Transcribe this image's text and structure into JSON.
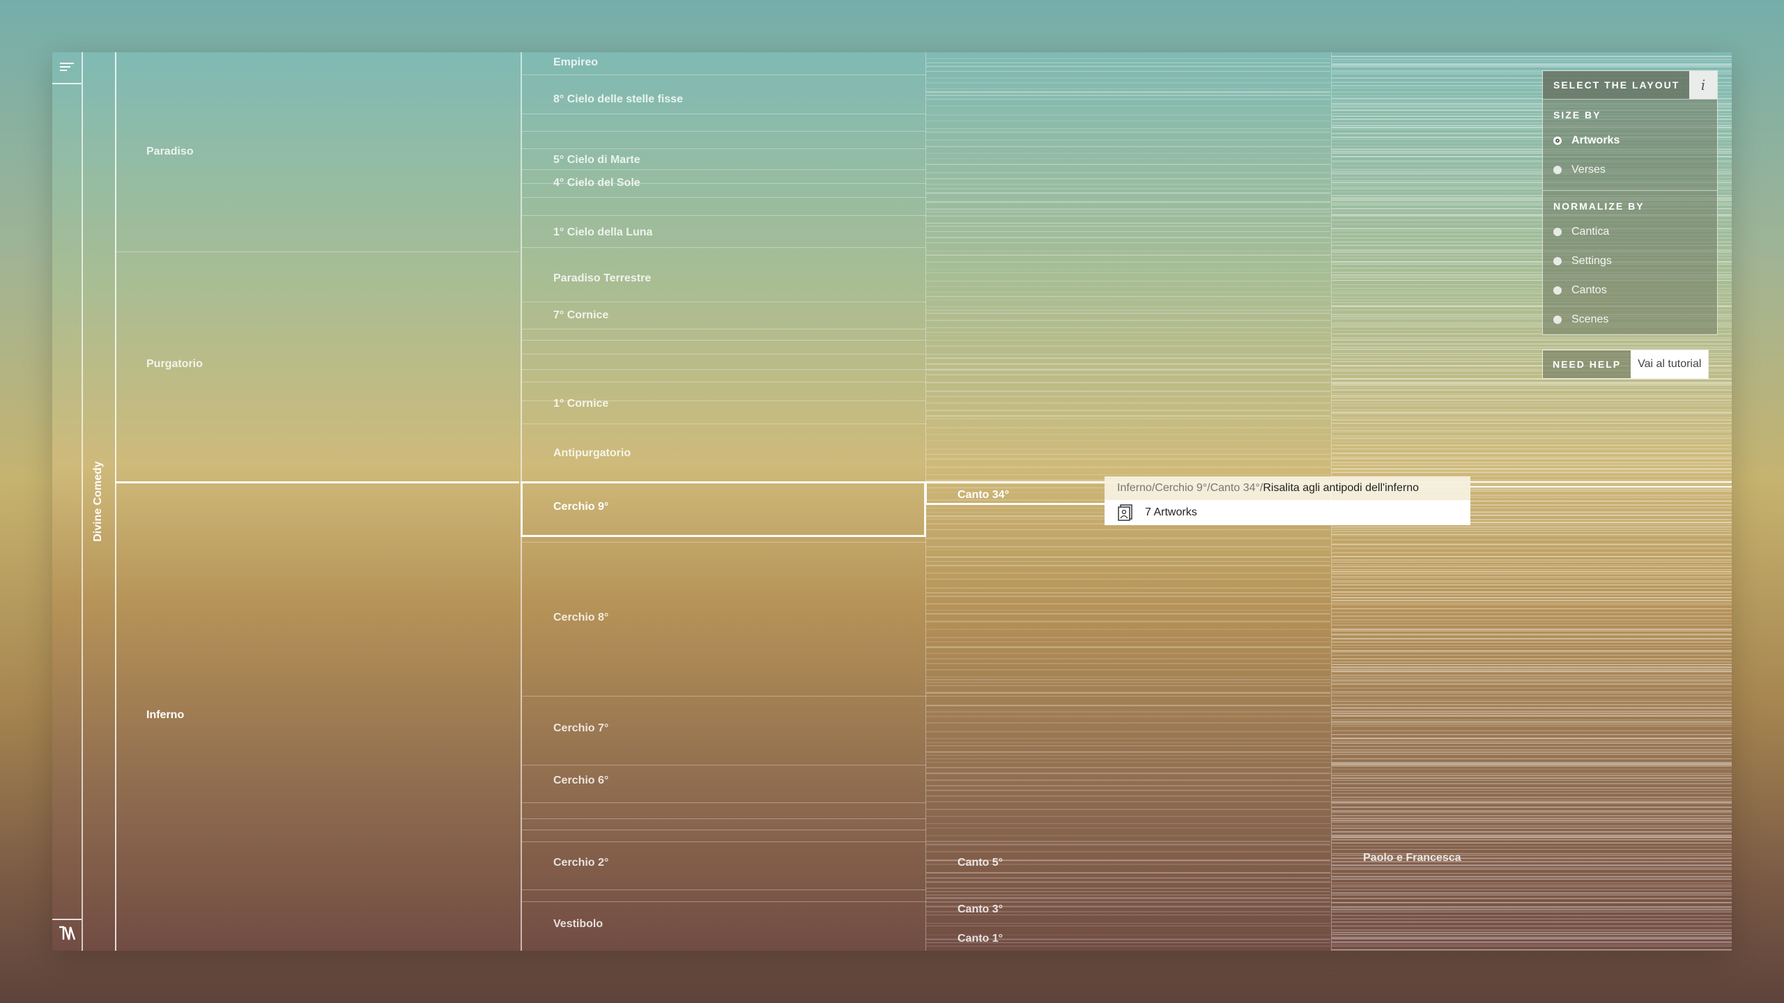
{
  "app": {
    "root_label": "Divine Comedy"
  },
  "icons": {
    "menu": "menu-icon",
    "logo": "logo-icon",
    "info": "info-icon",
    "artworks": "artworks-icon"
  },
  "canticas": [
    {
      "label": "Paradiso"
    },
    {
      "label": "Purgatorio"
    },
    {
      "label": "Inferno"
    }
  ],
  "settings": {
    "paradiso": [
      "Empireo",
      "8° Cielo delle stelle fisse",
      "5° Cielo di Marte",
      "4° Cielo del Sole",
      "1° Cielo della Luna"
    ],
    "purgatorio": [
      "Paradiso Terrestre",
      "7° Cornice",
      "1° Cornice",
      "Antipurgatorio"
    ],
    "inferno": [
      "Cerchio 9°",
      "Cerchio 8°",
      "Cerchio 7°",
      "Cerchio 6°",
      "Cerchio 2°",
      "Vestibolo"
    ]
  },
  "cantos": [
    "Canto 34°",
    "Canto 5°",
    "Canto 3°",
    "Canto 1°"
  ],
  "scenes": [
    "Paolo e Francesca"
  ],
  "panel": {
    "title": "SELECT THE LAYOUT",
    "info_label": "i",
    "size_by": {
      "title": "SIZE BY",
      "options": [
        "Artworks",
        "Verses"
      ],
      "selected": "Artworks"
    },
    "normalize_by": {
      "title": "NORMALIZE BY",
      "options": [
        "Cantica",
        "Settings",
        "Cantos",
        "Scenes"
      ]
    }
  },
  "help": {
    "label": "NEED HELP",
    "button": "Vai al tutorial"
  },
  "tooltip": {
    "path": "Inferno/Cerchio 9°/Canto 34°/",
    "current": "Risalita agli antipodi dell'inferno",
    "count": "7 Artworks"
  }
}
